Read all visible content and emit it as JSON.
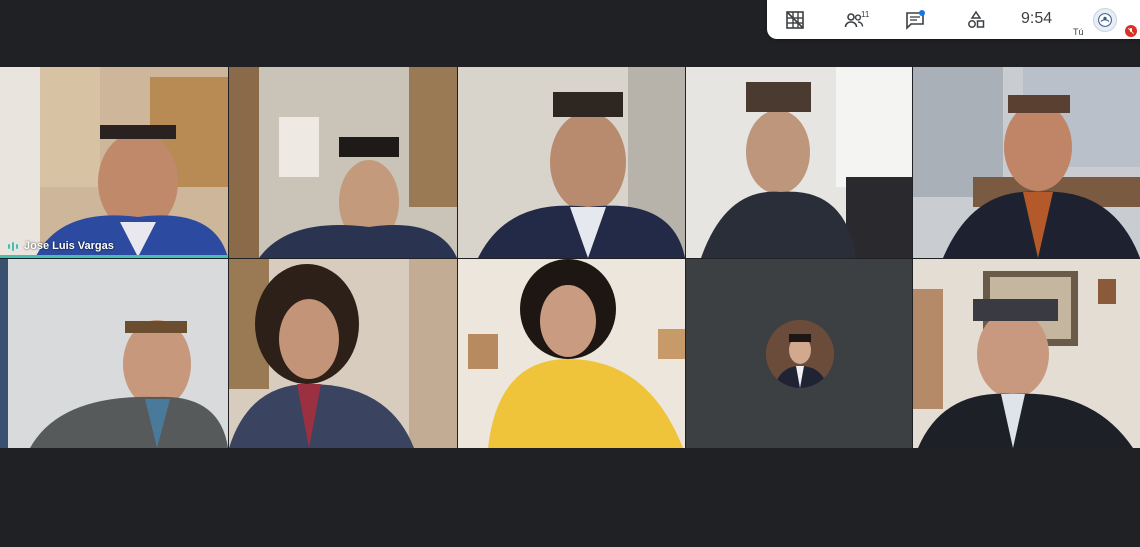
{
  "toolbar": {
    "buttons": [
      {
        "name": "tile-layout-icon"
      },
      {
        "name": "participants-icon",
        "badge": "11"
      },
      {
        "name": "chat-icon"
      },
      {
        "name": "activities-icon"
      }
    ],
    "time": "9:54",
    "self_label": "Tú"
  },
  "grid": {
    "tiles": [
      {
        "name": "Jose Luis Vargas",
        "speaking": true
      },
      {
        "name": ""
      },
      {
        "name": ""
      },
      {
        "name": ""
      },
      {
        "name": ""
      },
      {
        "name": ""
      },
      {
        "name": ""
      },
      {
        "name": ""
      },
      {
        "name": "",
        "avatar_only": true
      },
      {
        "name": ""
      }
    ]
  },
  "colors": {
    "background": "#202124",
    "speaking_accent": "#41c1b4",
    "toolbar_bg": "#ffffff",
    "mic_off": "#d93025"
  }
}
